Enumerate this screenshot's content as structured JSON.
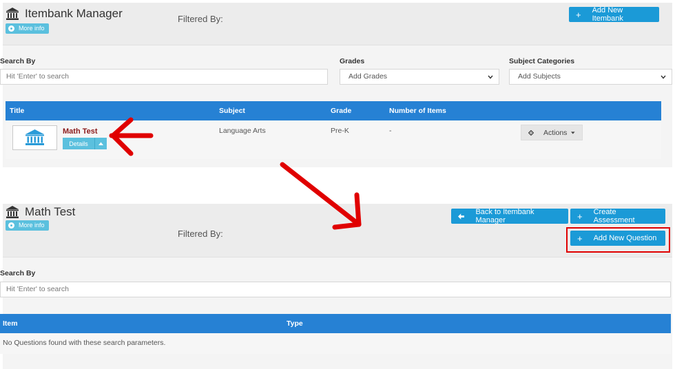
{
  "itembank_manager": {
    "title": "Itembank Manager",
    "more_info": "More info",
    "filtered_by": "Filtered By:",
    "add_button": "Add New Itembank",
    "search": {
      "label": "Search By",
      "placeholder": "Hit 'Enter' to search"
    },
    "grades": {
      "label": "Grades",
      "selected": "Add Grades"
    },
    "subjects": {
      "label": "Subject Categories",
      "selected": "Add Subjects"
    },
    "table": {
      "headers": [
        "Title",
        "Subject",
        "Grade",
        "Number of Items"
      ],
      "row": {
        "title": "Math Test",
        "details": "Details",
        "subject": "Language Arts",
        "grade": "Pre-K",
        "items": "-",
        "actions": "Actions"
      }
    }
  },
  "math_test": {
    "title": "Math Test",
    "more_info": "More info",
    "filtered_by": "Filtered By:",
    "back_button": "Back to Itembank Manager",
    "create_button": "Create Assessment",
    "add_question_button": "Add New Question",
    "search": {
      "label": "Search By",
      "placeholder": "Hit 'Enter' to search"
    },
    "table": {
      "headers": [
        "Item",
        "Type"
      ],
      "empty": "No Questions found with these search parameters."
    }
  },
  "colors": {
    "primary_button": "#1b9ad7",
    "table_header": "#2681d4",
    "info_button": "#5bc0de",
    "annotation": "#e00000",
    "item_title": "#8b1a1a"
  },
  "icons": {
    "bank": "bank-building-icon",
    "info": "info-circle-icon",
    "plus": "plus-icon",
    "arrow_left": "arrow-left-icon",
    "gear": "gear-icon",
    "caret": "caret-down-icon"
  }
}
